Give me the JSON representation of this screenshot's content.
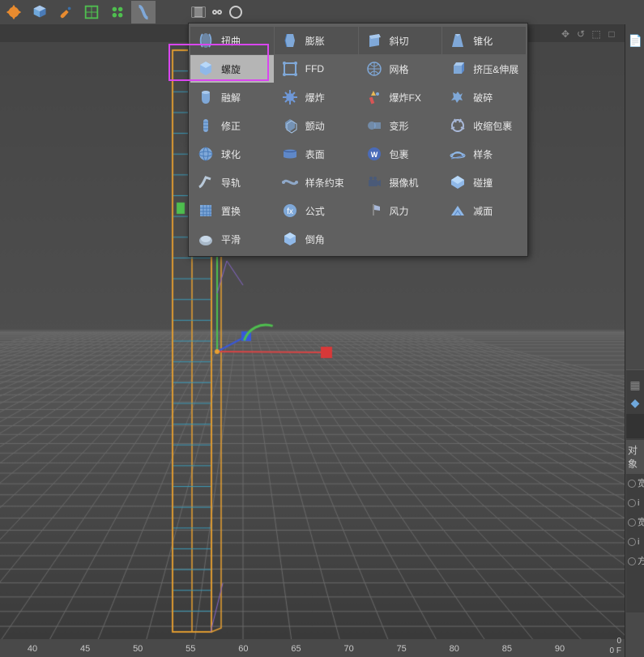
{
  "toolbar": {
    "items": [
      "gear-icon",
      "cube-icon",
      "brush-icon",
      "subdiv-icon",
      "cloner-icon",
      "deformer-icon"
    ]
  },
  "extras": [
    "film-icon",
    "eyes-icon",
    "circle-icon"
  ],
  "view_controls": [
    "✥",
    "↺",
    "⬚",
    "□"
  ],
  "deformer_menu": {
    "cols": [
      [
        {
          "icon": "twist",
          "label": "扭曲"
        },
        {
          "icon": "helix",
          "label": "螺旋",
          "hl": true
        },
        {
          "icon": "melt",
          "label": "融解"
        },
        {
          "icon": "correct",
          "label": "修正"
        },
        {
          "icon": "sphere",
          "label": "球化"
        },
        {
          "icon": "rail",
          "label": "导轨"
        },
        {
          "icon": "displace",
          "label": "置换"
        },
        {
          "icon": "smooth",
          "label": "平滑"
        }
      ],
      [
        {
          "icon": "bulge",
          "label": "膨胀"
        },
        {
          "icon": "ffd",
          "label": "FFD"
        },
        {
          "icon": "explode",
          "label": "爆炸"
        },
        {
          "icon": "jiggle",
          "label": "颤动"
        },
        {
          "icon": "surface",
          "label": "表面"
        },
        {
          "icon": "splinewrap",
          "label": "样条约束"
        },
        {
          "icon": "formula",
          "label": "公式"
        },
        {
          "icon": "bevel",
          "label": "倒角"
        }
      ],
      [
        {
          "icon": "shear",
          "label": "斜切"
        },
        {
          "icon": "mesh",
          "label": "网格"
        },
        {
          "icon": "explodefx",
          "label": "爆炸FX"
        },
        {
          "icon": "morph",
          "label": "变形"
        },
        {
          "icon": "wrap",
          "label": "包裹"
        },
        {
          "icon": "camera",
          "label": "摄像机"
        },
        {
          "icon": "wind",
          "label": "风力"
        }
      ],
      [
        {
          "icon": "taper",
          "label": "锥化"
        },
        {
          "icon": "extrude",
          "label": "挤压&伸展"
        },
        {
          "icon": "shatter",
          "label": "破碎"
        },
        {
          "icon": "shrink",
          "label": "收缩包裹"
        },
        {
          "icon": "spline",
          "label": "样条"
        },
        {
          "icon": "collide",
          "label": "碰撞"
        },
        {
          "icon": "reduce",
          "label": "减面"
        }
      ]
    ]
  },
  "timeline": {
    "ticks": [
      40,
      45,
      50,
      55,
      60,
      65,
      70,
      75,
      80,
      85,
      90
    ],
    "of": "0 F",
    "zero": "0"
  },
  "attr": {
    "title": "对象",
    "rows": [
      "宽",
      "i",
      "宽",
      "i",
      "方"
    ]
  }
}
